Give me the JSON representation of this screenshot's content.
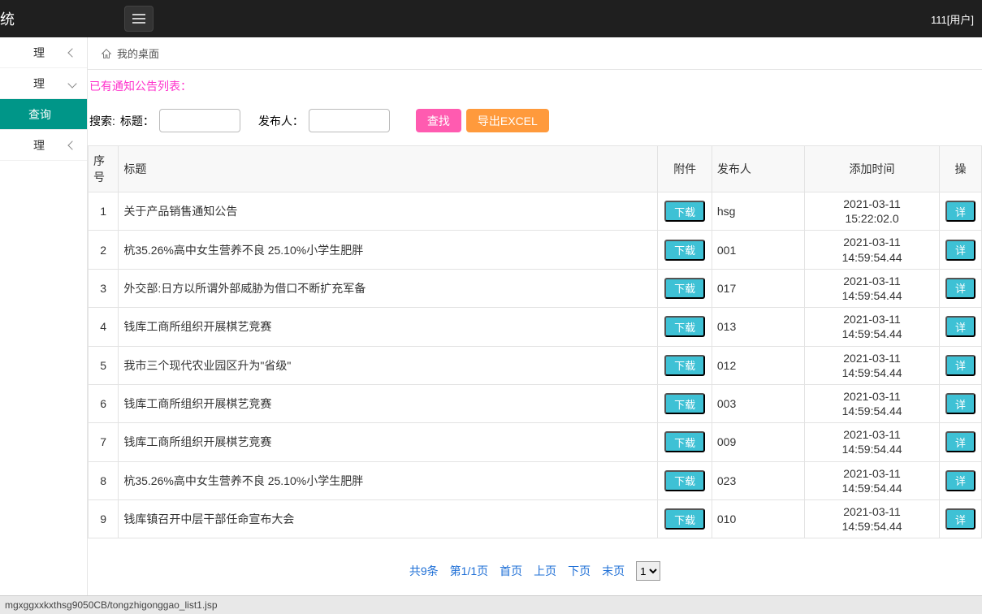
{
  "topbar": {
    "title": "统",
    "user": "111[用户]"
  },
  "sidebar": {
    "items": [
      {
        "label": "理",
        "chev": "left"
      },
      {
        "label": "理",
        "chev": "down"
      },
      {
        "label": "查询",
        "active": true
      },
      {
        "label": "理",
        "chev": "left"
      }
    ]
  },
  "tabbar": {
    "home": "我的桌面"
  },
  "page": {
    "list_title": "已有通知公告列表：",
    "search_label": "搜索:",
    "title_label": "标题：",
    "publisher_label": "发布人：",
    "search_btn": "查找",
    "export_btn": "导出EXCEL"
  },
  "table": {
    "headers": {
      "idx": "序号",
      "title": "标题",
      "attach": "附件",
      "publisher": "发布人",
      "time": "添加时间",
      "op": "操"
    },
    "download_label": "下载",
    "detail_label": "详",
    "rows": [
      {
        "idx": "1",
        "title": "关于产品销售通知公告",
        "publisher": "hsg",
        "time1": "2021-03-11",
        "time2": "15:22:02.0"
      },
      {
        "idx": "2",
        "title": "杭35.26%高中女生营养不良 25.10%小学生肥胖",
        "publisher": "001",
        "time1": "2021-03-11",
        "time2": "14:59:54.44"
      },
      {
        "idx": "3",
        "title": "外交部:日方以所谓外部威胁为借口不断扩充军备",
        "publisher": "017",
        "time1": "2021-03-11",
        "time2": "14:59:54.44"
      },
      {
        "idx": "4",
        "title": "钱库工商所组织开展棋艺竞赛",
        "publisher": "013",
        "time1": "2021-03-11",
        "time2": "14:59:54.44"
      },
      {
        "idx": "5",
        "title": "我市三个现代农业园区升为\"省级\"",
        "publisher": "012",
        "time1": "2021-03-11",
        "time2": "14:59:54.44"
      },
      {
        "idx": "6",
        "title": "钱库工商所组织开展棋艺竞赛",
        "publisher": "003",
        "time1": "2021-03-11",
        "time2": "14:59:54.44"
      },
      {
        "idx": "7",
        "title": "钱库工商所组织开展棋艺竞赛",
        "publisher": "009",
        "time1": "2021-03-11",
        "time2": "14:59:54.44"
      },
      {
        "idx": "8",
        "title": "杭35.26%高中女生营养不良 25.10%小学生肥胖",
        "publisher": "023",
        "time1": "2021-03-11",
        "time2": "14:59:54.44"
      },
      {
        "idx": "9",
        "title": "钱库镇召开中层干部任命宣布大会",
        "publisher": "010",
        "time1": "2021-03-11",
        "time2": "14:59:54.44"
      }
    ]
  },
  "pager": {
    "total": "共9条",
    "page_info": "第1/1页",
    "first": "首页",
    "prev": "上页",
    "next": "下页",
    "last": "末页",
    "select": "1"
  },
  "statusbar": "mgxggxxkxthsg9050CB/tongzhigonggao_list1.jsp"
}
